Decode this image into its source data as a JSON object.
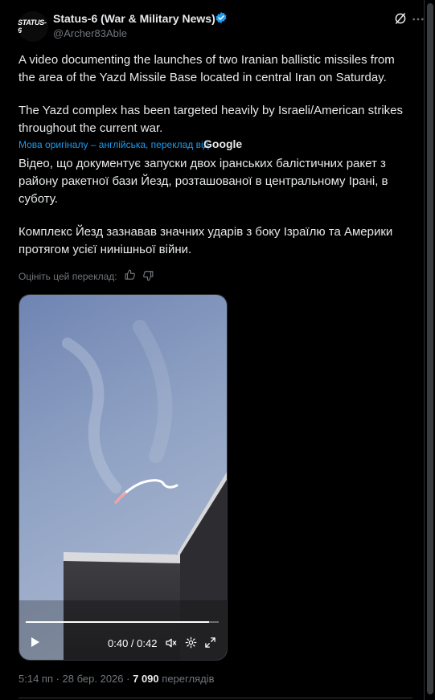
{
  "author": {
    "name": "Status-6 (War & Military News)",
    "handle": "@Archer83Able",
    "avatar_text": "STATUS-6",
    "verified_color": "#1d9bf0"
  },
  "post": {
    "paragraph1": "A video documenting the launches of two Iranian ballistic missiles from the area of the Yazd Missile Base located in central Iran on Saturday.",
    "paragraph2": "The Yazd complex has been targeted heavily by Israeli/American strikes throughout the current war."
  },
  "translation": {
    "note": "Мова оригіналу – англійська, переклад від",
    "provider": "Google",
    "paragraph1": "Відео, що документує запуски двох іранських балістичних ракет з району ракетної бази Йезд, розташованої в центральному Ірані, в суботу.",
    "paragraph2": "Комплекс Йезд зазнавав значних ударів з боку Ізраїлю та Америки протягом усієї нинішньої війни.",
    "rate_label": "Оцініть цей переклад:"
  },
  "video": {
    "current_time": "0:40",
    "separator": " / ",
    "duration": "0:42",
    "progress_fraction": 0.952
  },
  "meta": {
    "time": "5:14 пп",
    "dot": " · ",
    "date": "28 бер. 2026",
    "views_count": "7 090",
    "views_label": "переглядів"
  },
  "icons": {
    "verified": "verified-badge-icon",
    "grok": "grok-icon",
    "more": "more-icon",
    "thumb_up": "thumb-up-icon",
    "thumb_down": "thumb-down-icon",
    "play": "play-icon",
    "volume": "volume-icon",
    "settings": "settings-icon",
    "fullscreen": "fullscreen-icon"
  },
  "colors": {
    "background": "#000000",
    "text": "#e7e9ea",
    "muted": "#71767b",
    "accent": "#1d9bf0"
  }
}
